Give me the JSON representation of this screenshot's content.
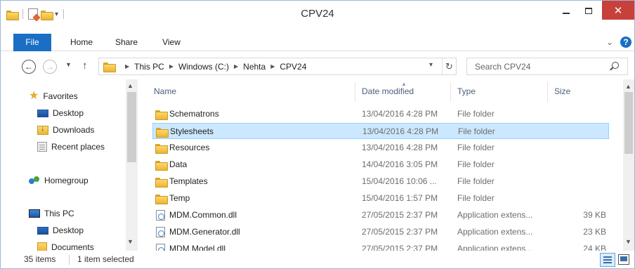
{
  "window": {
    "title": "CPV24"
  },
  "ribbon": {
    "tabs": [
      {
        "label": "File"
      },
      {
        "label": "Home"
      },
      {
        "label": "Share"
      },
      {
        "label": "View"
      }
    ]
  },
  "address": {
    "crumbs": [
      "This PC",
      "Windows (C:)",
      "Nehta",
      "CPV24"
    ]
  },
  "search": {
    "placeholder": "Search CPV24"
  },
  "nav_pane": {
    "favorites_label": "Favorites",
    "favorites": [
      "Desktop",
      "Downloads",
      "Recent places"
    ],
    "homegroup_label": "Homegroup",
    "this_pc_label": "This PC",
    "this_pc_items": [
      "Desktop",
      "Documents"
    ]
  },
  "columns": {
    "name": "Name",
    "date": "Date modified",
    "type": "Type",
    "size": "Size"
  },
  "files": [
    {
      "name": "Schematrons",
      "date": "13/04/2016 4:28 PM",
      "type": "File folder",
      "size": "",
      "kind": "folder",
      "selected": false
    },
    {
      "name": "Stylesheets",
      "date": "13/04/2016 4:28 PM",
      "type": "File folder",
      "size": "",
      "kind": "folder",
      "selected": true
    },
    {
      "name": "Resources",
      "date": "13/04/2016 4:28 PM",
      "type": "File folder",
      "size": "",
      "kind": "folder",
      "selected": false
    },
    {
      "name": "Data",
      "date": "14/04/2016 3:05 PM",
      "type": "File folder",
      "size": "",
      "kind": "folder",
      "selected": false
    },
    {
      "name": "Templates",
      "date": "15/04/2016 10:06 ...",
      "type": "File folder",
      "size": "",
      "kind": "folder",
      "selected": false
    },
    {
      "name": "Temp",
      "date": "15/04/2016 1:57 PM",
      "type": "File folder",
      "size": "",
      "kind": "folder",
      "selected": false
    },
    {
      "name": "MDM.Common.dll",
      "date": "27/05/2015 2:37 PM",
      "type": "Application extens...",
      "size": "39 KB",
      "kind": "dll",
      "selected": false
    },
    {
      "name": "MDM.Generator.dll",
      "date": "27/05/2015 2:37 PM",
      "type": "Application extens...",
      "size": "23 KB",
      "kind": "dll",
      "selected": false
    },
    {
      "name": "MDM.Model.dll",
      "date": "27/05/2015 2:37 PM",
      "type": "Application extens...",
      "size": "24 KB",
      "kind": "dll",
      "selected": false
    }
  ],
  "status": {
    "item_count": "35 items",
    "selection": "1 item selected"
  },
  "colors": {
    "accent": "#1a6fc4",
    "selection_bg": "#cce8ff",
    "selection_border": "#99d1ff",
    "close_button": "#c7403a"
  }
}
